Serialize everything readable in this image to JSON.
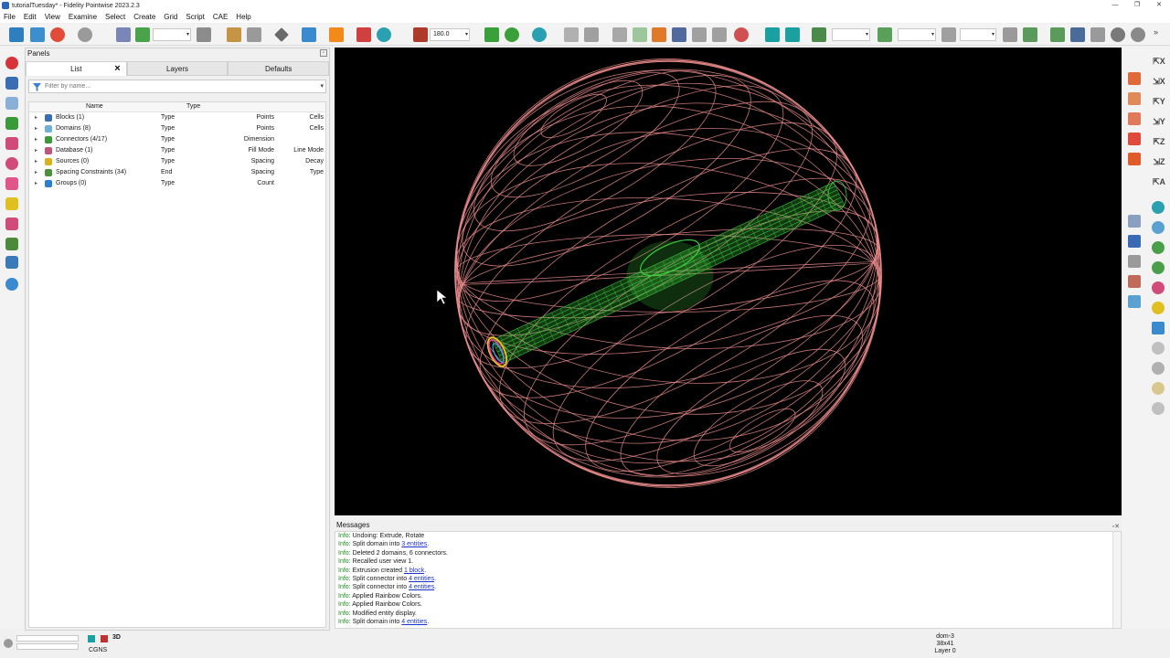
{
  "window": {
    "title": "tutorialTuesday* - Fidelity Pointwise 2023.2.3",
    "controls": [
      "—",
      "❐",
      "✕"
    ]
  },
  "menu": [
    "File",
    "Edit",
    "View",
    "Examine",
    "Select",
    "Create",
    "Grid",
    "Script",
    "CAE",
    "Help"
  ],
  "toolbar": {
    "angle_value": "180.0"
  },
  "panels": {
    "title": "Panels",
    "tabs": [
      "List",
      "Layers",
      "Defaults"
    ],
    "filter_placeholder": "Filter by name...",
    "columns": [
      "Name",
      "Type"
    ],
    "rows": [
      {
        "name": "Blocks (1)",
        "c1": "Type",
        "c2": "Points",
        "c3": "Cells",
        "icon_color": "#3b6db3"
      },
      {
        "name": "Domains (8)",
        "c1": "Type",
        "c2": "Points",
        "c3": "Cells",
        "icon_color": "#6fb1d6"
      },
      {
        "name": "Connectors (4/17)",
        "c1": "Type",
        "c2": "Dimension",
        "c3": "",
        "icon_color": "#3a9a3a"
      },
      {
        "name": "Database (1)",
        "c1": "Type",
        "c2": "Fill Mode",
        "c3": "Line Mode",
        "icon_color": "#c0547a"
      },
      {
        "name": "Sources (0)",
        "c1": "Type",
        "c2": "Spacing",
        "c3": "Decay",
        "icon_color": "#d8b11f"
      },
      {
        "name": "Spacing Constraints (34)",
        "c1": "End",
        "c2": "Spacing",
        "c3": "Type",
        "icon_color": "#4c8f3c"
      },
      {
        "name": "Groups (0)",
        "c1": "Type",
        "c2": "Count",
        "c3": "",
        "icon_color": "#2a7fd0"
      }
    ]
  },
  "messages": {
    "title": "Messages",
    "lines": [
      {
        "level": "Info:",
        "text": "Undoing: Extrude, Rotate",
        "link": "",
        "tail": ""
      },
      {
        "level": "Info:",
        "text": "Split domain into ",
        "link": "3 entities",
        "tail": "."
      },
      {
        "level": "Info:",
        "text": "Deleted 2 domains, 6 connectors.",
        "link": "",
        "tail": ""
      },
      {
        "level": "Info:",
        "text": "Recalled user view 1.",
        "link": "",
        "tail": ""
      },
      {
        "level": "Info:",
        "text": "Extrusion created ",
        "link": "1 block",
        "tail": "."
      },
      {
        "level": "Info:",
        "text": "Split connector into ",
        "link": "4 entities",
        "tail": "."
      },
      {
        "level": "Info:",
        "text": "Split connector into ",
        "link": "4 entities",
        "tail": "."
      },
      {
        "level": "Info:",
        "text": "Applied Rainbow Colors.",
        "link": "",
        "tail": ""
      },
      {
        "level": "Info:",
        "text": "Applied Rainbow Colors.",
        "link": "",
        "tail": ""
      },
      {
        "level": "Info:",
        "text": "Modified entity display.",
        "link": "",
        "tail": ""
      },
      {
        "level": "Info:",
        "text": "Split domain into ",
        "link": "4 entities",
        "tail": "."
      }
    ]
  },
  "statusbar": {
    "solver": "CGNS",
    "mode_3d": "3D",
    "selection": {
      "entity": "dom-3",
      "dims": "38x41",
      "layer": "Layer 0"
    }
  },
  "colors": {
    "sphere": "#e88a8a",
    "tube": "#3fcf3f",
    "ring": [
      "#e6c020",
      "#e040a0",
      "#40a0e0"
    ]
  }
}
